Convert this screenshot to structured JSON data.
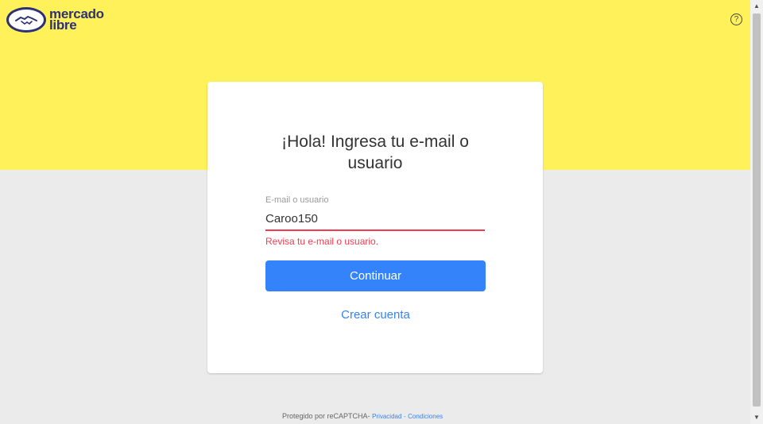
{
  "header": {
    "logo_line1": "mercado",
    "logo_line2": "libre",
    "help_symbol": "?",
    "background_color": "#fff159"
  },
  "login": {
    "title": "¡Hola! Ingresa tu e-mail o usuario",
    "field_label": "E-mail o usuario",
    "field_value": "Caroo150",
    "error_message": "Revisa tu e-mail o usuario.",
    "continue_label": "Continuar",
    "create_account_label": "Crear cuenta",
    "accent_color": "#3483fa",
    "error_color": "#f23d4f"
  },
  "footer": {
    "protected_text": "Protegido por reCAPTCHA-",
    "privacy_label": "Privacidad",
    "separator": "-",
    "terms_label": "Condiciones"
  }
}
